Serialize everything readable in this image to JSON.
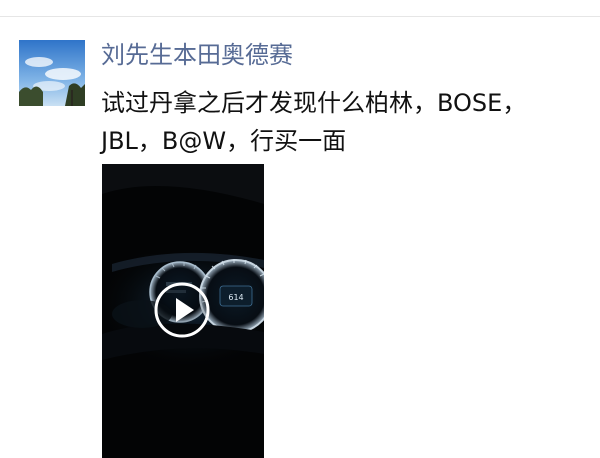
{
  "post": {
    "author": "刘先生本田奥德赛",
    "text": "试过丹拿之后才发现什么柏林，BOSE，JBL，B@W，行买一面",
    "video": {
      "play_icon": "play-icon",
      "dashboard_reading": "614"
    }
  },
  "colors": {
    "author_name": "#576b95",
    "body_text": "#111111",
    "divider": "#e6e6e6",
    "video_bg": "#030405"
  }
}
